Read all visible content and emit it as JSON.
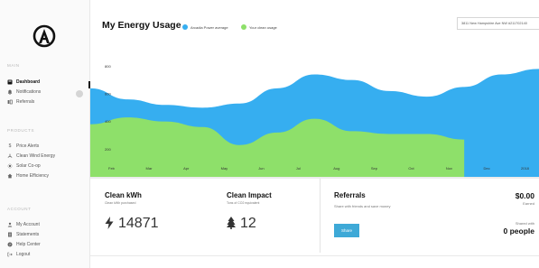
{
  "sidebar": {
    "sections": {
      "main": "MAIN",
      "products": "PRODUCTS",
      "account": "ACCOUNT"
    },
    "main_items": [
      {
        "label": "Dashboard",
        "icon": "dashboard-icon",
        "active": true
      },
      {
        "label": "Notifications",
        "icon": "bell-icon"
      },
      {
        "label": "Referrals",
        "icon": "referrals-icon"
      }
    ],
    "product_items": [
      {
        "label": "Price Alerts",
        "icon": "dollar-icon"
      },
      {
        "label": "Clean Wind Energy",
        "icon": "wind-icon"
      },
      {
        "label": "Solar Co-op",
        "icon": "sun-icon"
      },
      {
        "label": "Home Efficiency",
        "icon": "home-icon"
      }
    ],
    "account_items": [
      {
        "label": "My Account",
        "icon": "user-icon"
      },
      {
        "label": "Statements",
        "icon": "document-icon"
      },
      {
        "label": "Help Center",
        "icon": "help-icon"
      },
      {
        "label": "Logout",
        "icon": "logout-icon"
      }
    ]
  },
  "header": {
    "title": "My Energy Usage",
    "legend": [
      {
        "label": "Arcadia Power average",
        "color": "#36aef0"
      },
      {
        "label": "Your clean usage",
        "color": "#8ee06a"
      }
    ],
    "address": "3811 New Hampshire Ave NW #211702140"
  },
  "chart_data": {
    "type": "area",
    "categories": [
      "Feb",
      "Mar",
      "Apr",
      "May",
      "Jun",
      "Jul",
      "Aug",
      "Sep",
      "Oct",
      "Nov",
      "Dec",
      "2018"
    ],
    "yticks": [
      800,
      600,
      400,
      200
    ],
    "ylim": [
      0,
      900
    ],
    "series": [
      {
        "name": "Arcadia Power average",
        "color": "#36aef0",
        "values": [
          640,
          560,
          520,
          500,
          530,
          640,
          740,
          700,
          620,
          580,
          650,
          740,
          780
        ]
      },
      {
        "name": "Your clean usage",
        "color": "#8ee06a",
        "values": [
          380,
          430,
          400,
          360,
          230,
          320,
          420,
          330,
          310,
          310,
          270,
          0,
          0
        ]
      }
    ]
  },
  "cards": {
    "clean_kwh": {
      "title": "Clean kWh",
      "subtitle": "Clean kWh purchased",
      "value": "14871",
      "icon": "lightning-icon"
    },
    "clean_impact": {
      "title": "Clean Impact",
      "subtitle": "Tons of CO2 equivalent",
      "value": "12",
      "icon": "tree-icon"
    },
    "referrals": {
      "title": "Referrals",
      "subtitle": "Share with friends and save money",
      "button": "Share",
      "earned_value": "$0.00",
      "earned_label": "Earned",
      "shared_label": "Shared with",
      "shared_value": "0 people"
    }
  }
}
